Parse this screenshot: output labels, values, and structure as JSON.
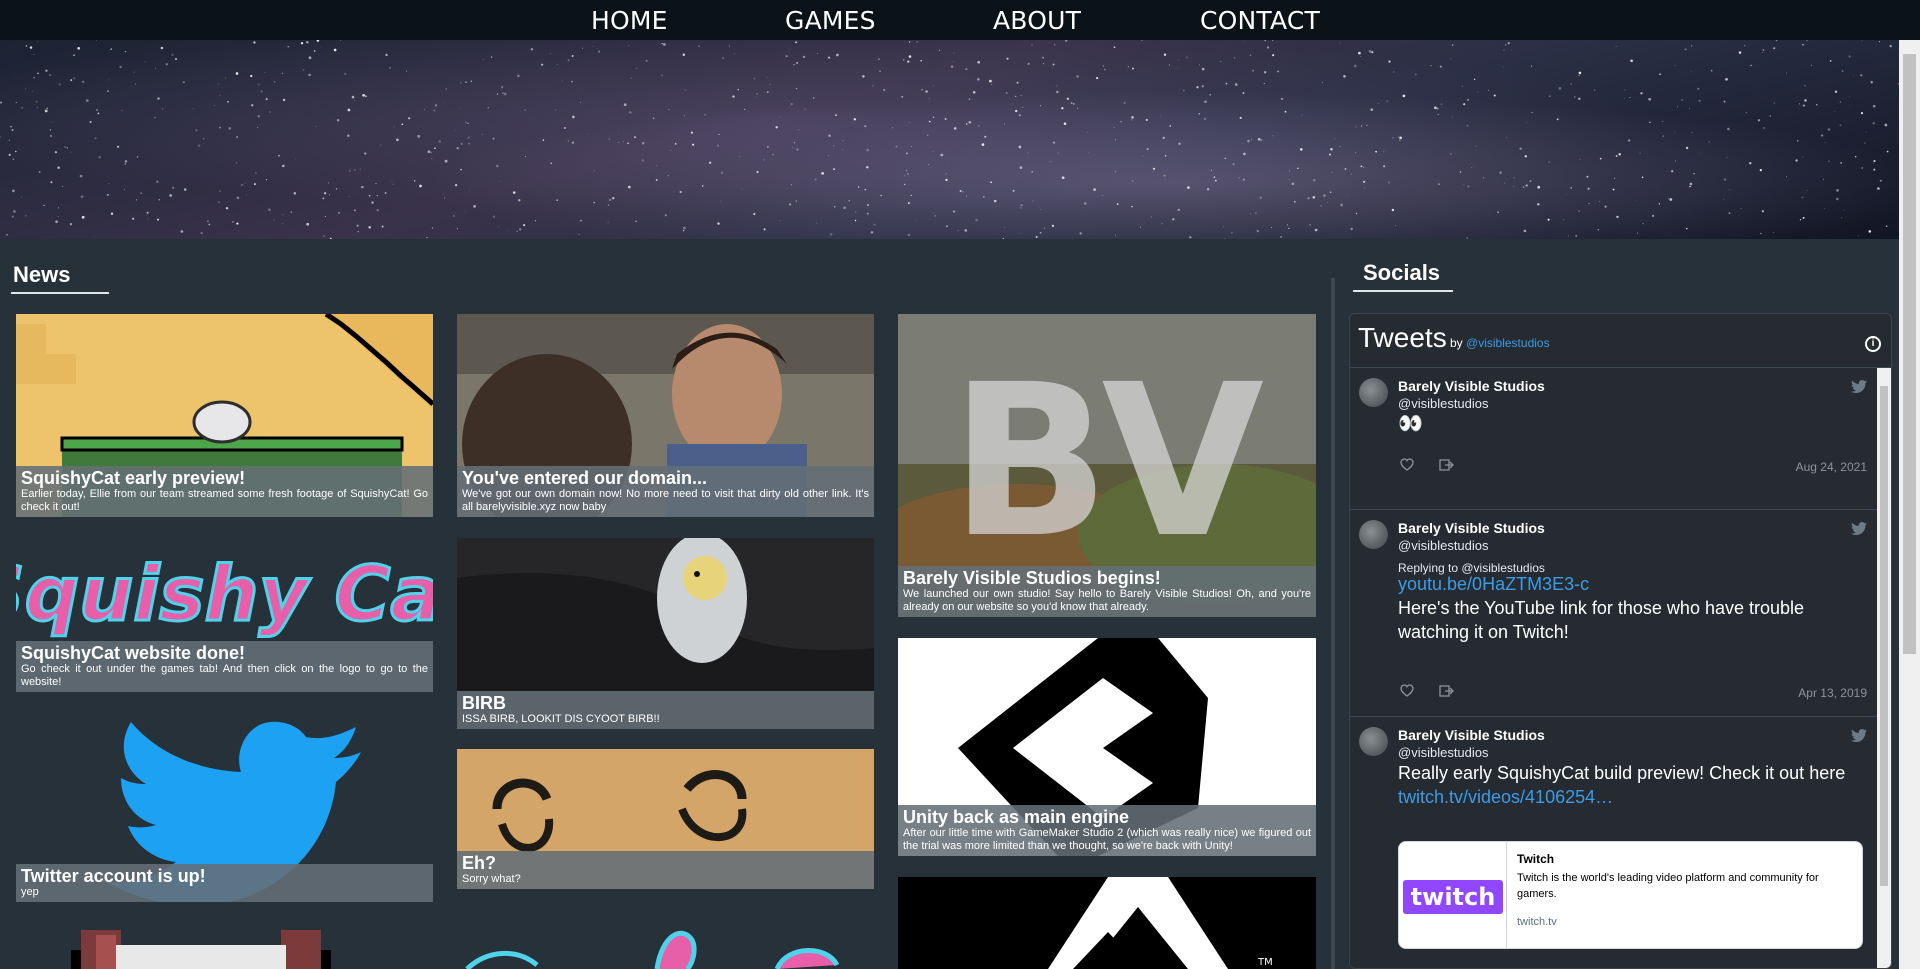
{
  "nav": {
    "home": "HOME",
    "games": "GAMES",
    "about": "ABOUT",
    "contact": "CONTACT"
  },
  "news": {
    "title": "News",
    "cards": [
      {
        "title": "SquishyCat early preview!",
        "desc": "Earlier today, Ellie from our team streamed some fresh footage of SquishyCat! Go check it out!"
      },
      {
        "title": "You've entered our domain...",
        "desc": "We've got our own domain now! No more need to visit that dirty old other link. It's all barelyvisible.xyz now baby"
      },
      {
        "title": "Barely Visible Studios begins!",
        "desc": "We launched our own studio! Say hello to Barely Visible Studios! Oh, and you're already on our website so you'd know that already."
      },
      {
        "title": "SquishyCat website done!",
        "desc": "Go check it out under the games tab! And then click on the logo to go to the website!"
      },
      {
        "title": "BIRB",
        "desc": "ISSA BIRB, LOOKIT DIS CYOOT BIRB!!"
      },
      {
        "title": "Unity back as main engine",
        "desc": "After our little time with GameMaker Studio 2 (which was really nice) we figured out the trial was more limited than we thought, so we're back with Unity!"
      },
      {
        "title": "Twitter account is up!",
        "desc": "yep"
      },
      {
        "title": "Eh?",
        "desc": "Sorry what?"
      }
    ],
    "squishy_logo_text": "Squishy Cat",
    "bv_logo_text": "BV",
    "tm_mark": "TM"
  },
  "socials": {
    "title": "Socials",
    "widget_title": "Tweets",
    "by": "by",
    "handle_link": "@visiblestudios",
    "info_icon": "i",
    "tweets": [
      {
        "name": "Barely Visible Studios",
        "handle": "@visiblestudios",
        "text": "👀",
        "date": "Aug 24, 2021"
      },
      {
        "name": "Barely Visible Studios",
        "handle": "@visiblestudios",
        "reply": "Replying to @visiblestudios",
        "link": "youtu.be/0HaZTM3E3-c",
        "text": "Here's the YouTube link for those who have trouble watching it on Twitch!",
        "date": "Apr 13, 2019"
      },
      {
        "name": "Barely Visible Studios",
        "handle": "@visiblestudios",
        "text": "Really early SquishyCat build preview! Check it out here",
        "link": "twitch.tv/videos/4106254…"
      }
    ],
    "embed": {
      "title": "Twitch",
      "desc": "Twitch is the world's leading video platform and community for gamers.",
      "url": "twitch.tv",
      "logo_text": "twitch"
    }
  },
  "colors": {
    "background": "#27313a",
    "nav": "#0b1218",
    "link": "#3b9ce8",
    "caption": "#646e76",
    "twitch": "#9146ff",
    "twitter": "#1da1f2"
  }
}
